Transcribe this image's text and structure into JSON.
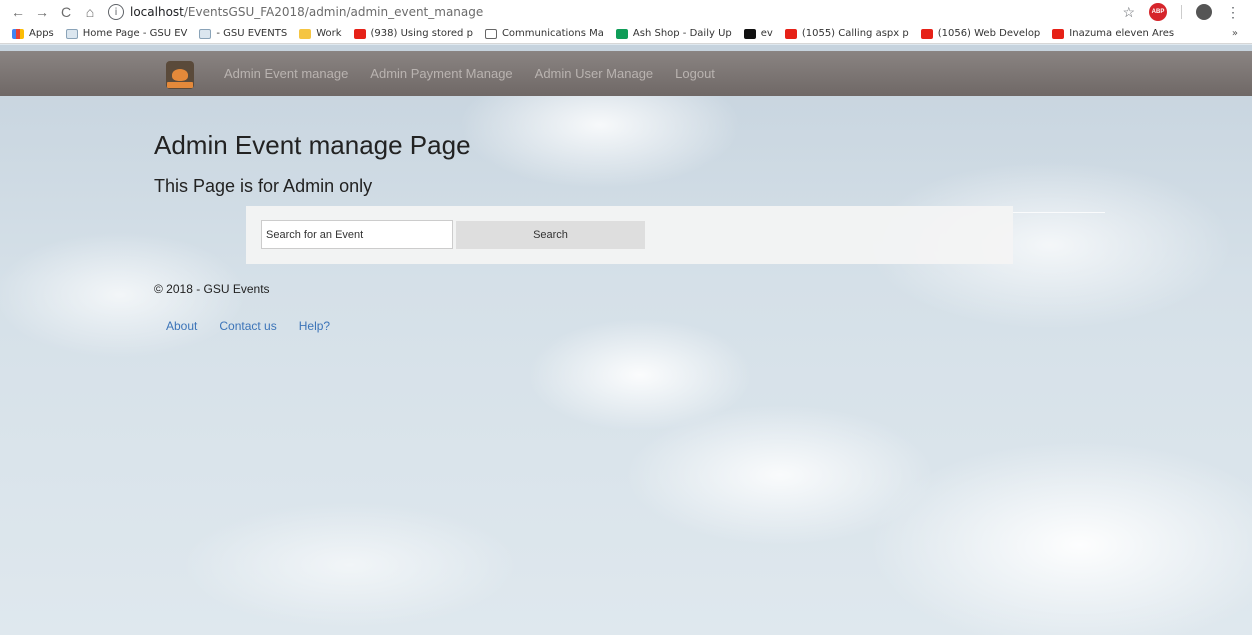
{
  "browser": {
    "url_host": "localhost",
    "url_path": "/EventsGSU_FA2018/admin/admin_event_manage",
    "nav_back": "←",
    "nav_forward": "→",
    "nav_reload": "C",
    "nav_home": "⌂",
    "info_icon": "i",
    "star_icon": "☆",
    "abp_label": "ABP",
    "menu_icon": "⋮",
    "bookmarks": [
      {
        "label": "Apps",
        "icon": "apps-icon"
      },
      {
        "label": "Home Page - GSU EV",
        "icon": "page-icon"
      },
      {
        "label": "- GSU EVENTS",
        "icon": "page-icon"
      },
      {
        "label": "Work",
        "icon": "folder-icon"
      },
      {
        "label": "(938) Using stored p",
        "icon": "youtube-icon"
      },
      {
        "label": "Communications Ma",
        "icon": "doc-icon"
      },
      {
        "label": "Ash Shop - Daily Up",
        "icon": "sheet-icon"
      },
      {
        "label": "ev",
        "icon": "github-icon"
      },
      {
        "label": "(1055) Calling aspx p",
        "icon": "youtube-icon"
      },
      {
        "label": "(1056) Web Develop",
        "icon": "youtube-icon"
      },
      {
        "label": "Inazuma eleven Ares",
        "icon": "youtube-icon"
      }
    ],
    "bookmarks_more": "»"
  },
  "navbar": {
    "links": [
      "Admin Event manage",
      "Admin Payment Manage",
      "Admin User Manage",
      "Logout"
    ]
  },
  "main": {
    "title": "Admin Event manage Page",
    "subtitle": "This Page is for Admin only",
    "search": {
      "placeholder": "Search for an Event",
      "value": "",
      "button_label": "Search"
    }
  },
  "footer": {
    "copyright": "© 2018 - GSU Events",
    "links": [
      "About",
      "Contact us",
      "Help?"
    ]
  }
}
